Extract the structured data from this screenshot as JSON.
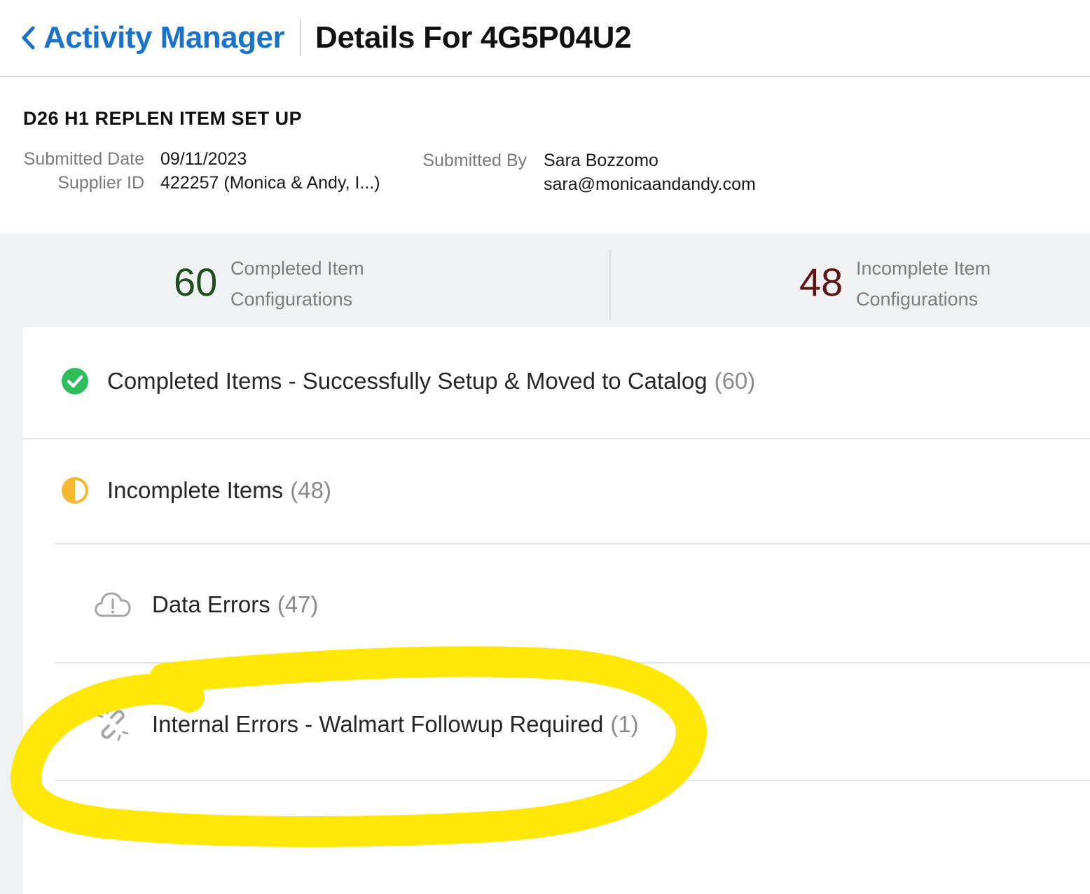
{
  "header": {
    "back_label": "Activity Manager",
    "title": "Details For 4G5P04U2"
  },
  "submission": {
    "set_name": "D26 H1 REPLEN ITEM SET UP",
    "submitted_date_label": "Submitted Date",
    "submitted_date": "09/11/2023",
    "supplier_id_label": "Supplier ID",
    "supplier_id": "422257 (Monica & Andy, I...)",
    "submitted_by_label": "Submitted By",
    "submitted_by_name": "Sara Bozzomo",
    "submitted_by_email": "sara@monicaandandy.com"
  },
  "stats": {
    "completed": {
      "count": "60",
      "line1": "Completed Item",
      "line2": "Configurations",
      "color": "#1e4d1e"
    },
    "incomplete": {
      "count": "48",
      "line1": "Incomplete Item",
      "line2": "Configurations",
      "color": "#5a1515"
    }
  },
  "categories": [
    {
      "label": "Completed Items - Successfully Setup & Moved to Catalog",
      "count": "(60)",
      "icon": "check-circle-icon",
      "color": "#2dbe5a"
    },
    {
      "label": "Incomplete Items",
      "count": "(48)",
      "icon": "half-circle-icon",
      "color": "#f5b82e"
    },
    {
      "label": "Data Errors",
      "count": "(47)",
      "icon": "cloud-alert-icon",
      "color": "#9a9a9a"
    },
    {
      "label": "Internal Errors - Walmart Followup Required",
      "count": "(1)",
      "icon": "broken-link-icon",
      "color": "#9a9a9a"
    }
  ],
  "annotation": {
    "color": "#ffe600"
  }
}
